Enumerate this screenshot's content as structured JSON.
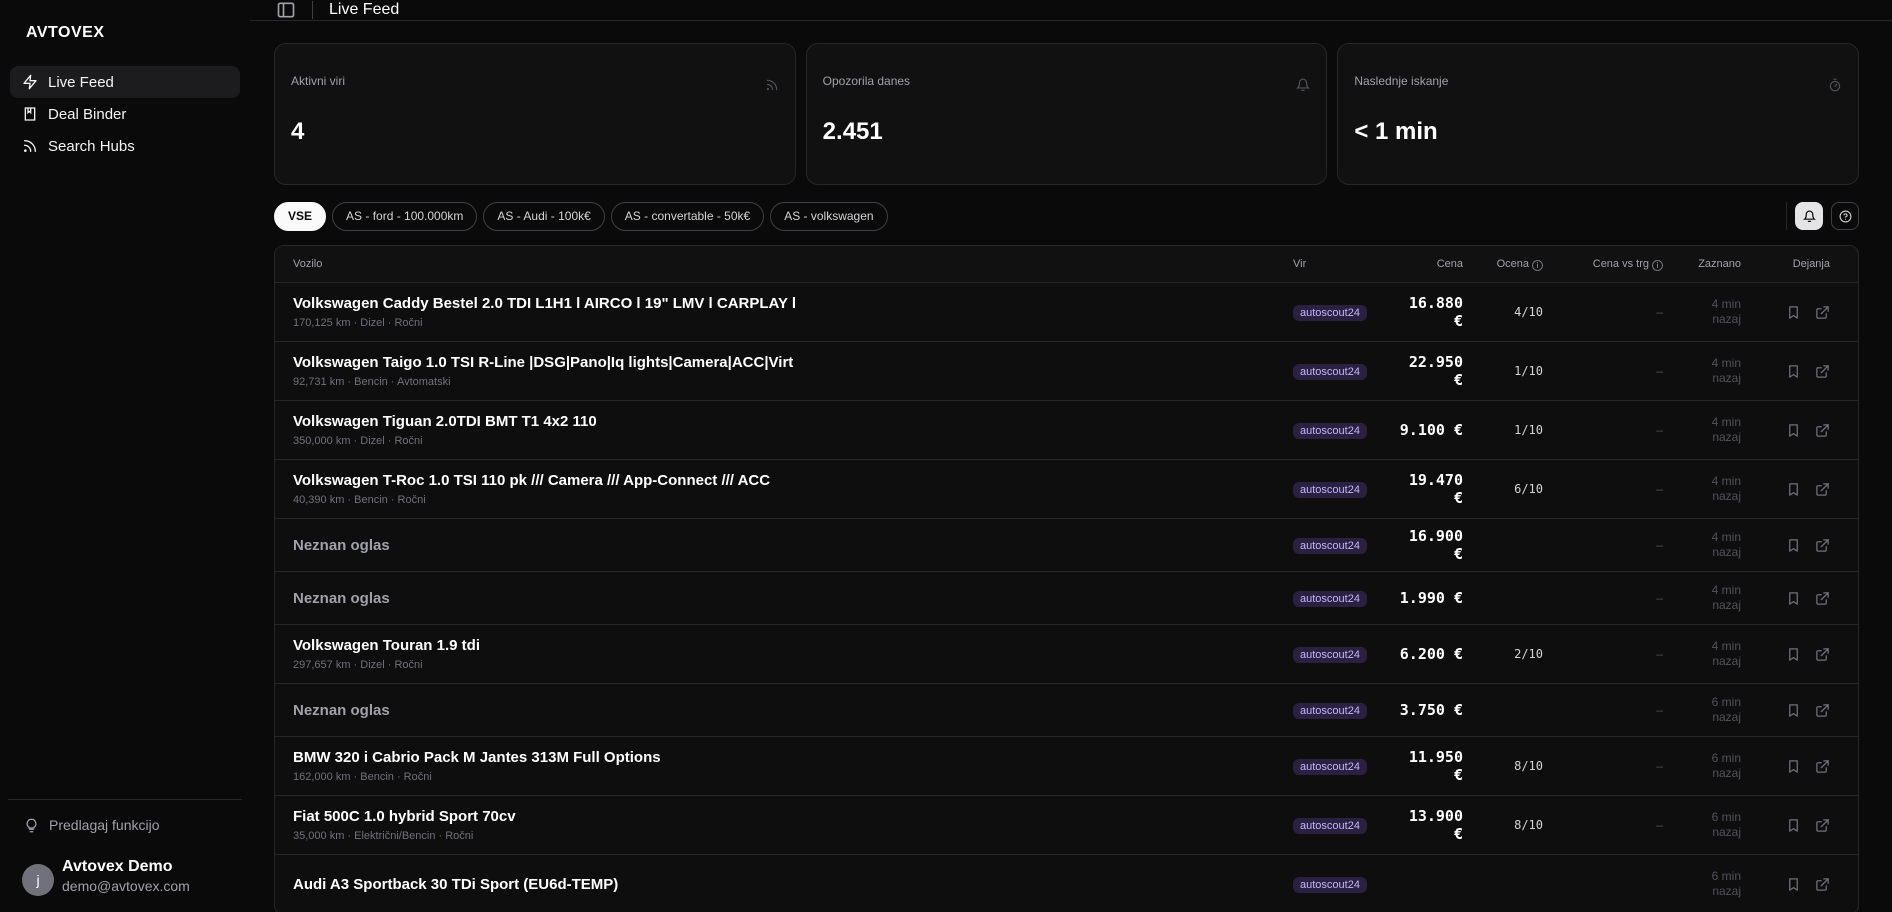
{
  "brand": "AVTOVEX",
  "sidebar": {
    "items": [
      {
        "label": "Live Feed",
        "icon": "zap-icon",
        "active": true
      },
      {
        "label": "Deal Binder",
        "icon": "book-icon"
      },
      {
        "label": "Search Hubs",
        "icon": "rss-icon"
      }
    ],
    "suggest": "Predlagaj funkcijo",
    "user": {
      "initial": "j",
      "name": "Avtovex Demo",
      "email": "demo@avtovex.com"
    }
  },
  "header": {
    "title": "Live Feed"
  },
  "stats": [
    {
      "label": "Aktivni viri",
      "value": "4",
      "icon": "rss-icon"
    },
    {
      "label": "Opozorila danes",
      "value": "2.451",
      "icon": "bell-icon"
    },
    {
      "label": "Naslednje iskanje",
      "value": "< 1 min",
      "icon": "timer-icon"
    }
  ],
  "filters": [
    "VSE",
    "AS - ford - 100.000km",
    "AS - Audi - 100k€",
    "AS - convertable - 50k€",
    "AS - volkswagen"
  ],
  "table": {
    "columns": {
      "vehicle": "Vozilo",
      "source": "Vir",
      "price": "Cena",
      "score": "Ocena",
      "vs": "Cena vs trg",
      "seen": "Zaznano",
      "actions": "Dejanja"
    },
    "rows": [
      {
        "title": "Volkswagen Caddy Bestel 2.0 TDI L1H1 l AIRCO l 19\" LMV l CARPLAY l",
        "meta": "170,125 km · Dizel · Ročni",
        "source": "autoscout24",
        "price": "16.880 €",
        "score": "4/10",
        "vs": "–",
        "seen1": "4 min",
        "seen2": "nazaj"
      },
      {
        "title": "Volkswagen Taigo 1.0 TSI R-Line |DSG|Pano|Iq lights|Camera|ACC|Virt",
        "meta": "92,731 km · Bencin · Avtomatski",
        "source": "autoscout24",
        "price": "22.950 €",
        "score": "1/10",
        "vs": "–",
        "seen1": "4 min",
        "seen2": "nazaj"
      },
      {
        "title": "Volkswagen Tiguan 2.0TDI BMT T1 4x2 110",
        "meta": "350,000 km · Dizel · Ročni",
        "source": "autoscout24",
        "price": "9.100 €",
        "score": "1/10",
        "vs": "–",
        "seen1": "4 min",
        "seen2": "nazaj"
      },
      {
        "title": "Volkswagen T-Roc 1.0 TSI 110 pk /// Camera /// App-Connect /// ACC",
        "meta": "40,390 km · Bencin · Ročni",
        "source": "autoscout24",
        "price": "19.470 €",
        "score": "6/10",
        "vs": "–",
        "seen1": "4 min",
        "seen2": "nazaj"
      },
      {
        "title": "Neznan oglas",
        "meta": "",
        "unknown": true,
        "source": "autoscout24",
        "price": "16.900 €",
        "score": "",
        "vs": "–",
        "seen1": "4 min",
        "seen2": "nazaj"
      },
      {
        "title": "Neznan oglas",
        "meta": "",
        "unknown": true,
        "source": "autoscout24",
        "price": "1.990 €",
        "score": "",
        "vs": "–",
        "seen1": "4 min",
        "seen2": "nazaj"
      },
      {
        "title": "Volkswagen Touran 1.9 tdi",
        "meta": "297,657 km · Dizel · Ročni",
        "source": "autoscout24",
        "price": "6.200 €",
        "score": "2/10",
        "vs": "–",
        "seen1": "4 min",
        "seen2": "nazaj"
      },
      {
        "title": "Neznan oglas",
        "meta": "",
        "unknown": true,
        "source": "autoscout24",
        "price": "3.750 €",
        "score": "",
        "vs": "–",
        "seen1": "6 min",
        "seen2": "nazaj"
      },
      {
        "title": "BMW 320 i Cabrio Pack M Jantes 313M Full Options",
        "meta": "162,000 km · Bencin · Ročni",
        "source": "autoscout24",
        "price": "11.950 €",
        "score": "8/10",
        "vs": "–",
        "seen1": "6 min",
        "seen2": "nazaj"
      },
      {
        "title": "Fiat 500C 1.0 hybrid Sport 70cv",
        "meta": "35,000 km · Električni/Bencin · Ročni",
        "source": "autoscout24",
        "price": "13.900 €",
        "score": "8/10",
        "vs": "–",
        "seen1": "6 min",
        "seen2": "nazaj"
      },
      {
        "title": "Audi A3 Sportback 30 TDi Sport (EU6d-TEMP)",
        "meta": "",
        "source": "autoscout24",
        "price": "",
        "score": "",
        "vs": "",
        "seen1": "6 min",
        "seen2": "nazaj"
      }
    ]
  },
  "colors": {
    "background": "#0a0a0a",
    "card": "#111111",
    "border": "#27272a",
    "badge_bg": "#2a2140",
    "badge_text": "#c4b5fd"
  }
}
